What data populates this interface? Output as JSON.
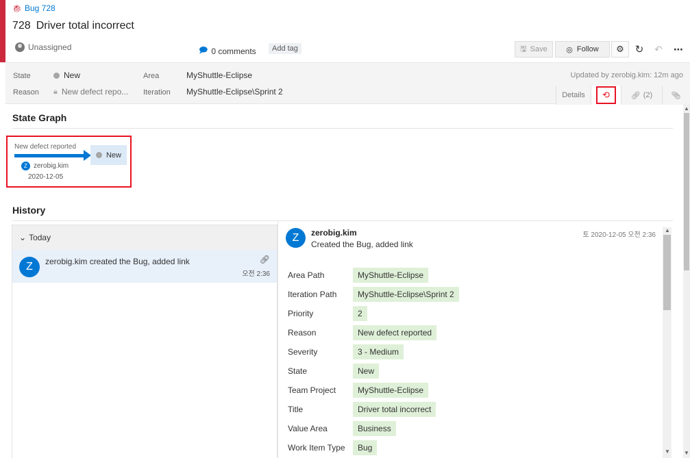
{
  "header": {
    "bug_label": "Bug 728",
    "item_id": "728",
    "title": "Driver total incorrect",
    "assigned": "Unassigned",
    "comments": "0 comments",
    "add_tag": "Add tag",
    "accent_color": "#cc293d"
  },
  "toolbar": {
    "save": "Save",
    "follow": "Follow",
    "icons": [
      "save-icon",
      "eye-icon",
      "gear-icon",
      "refresh-icon",
      "undo-icon",
      "more-icon"
    ]
  },
  "fields": {
    "state_label": "State",
    "state_value": "New",
    "reason_label": "Reason",
    "reason_value": "New defect repo...",
    "area_label": "Area",
    "area_value": "MyShuttle-Eclipse",
    "iteration_label": "Iteration",
    "iteration_value": "MyShuttle-Eclipse\\Sprint 2",
    "updated": "Updated by zerobig.kim: 12m ago"
  },
  "tabs": {
    "details": "Details",
    "links_count": "(2)"
  },
  "state_graph": {
    "title": "State Graph",
    "reason": "New defect reported",
    "state": "New",
    "user": "zerobig.kim",
    "user_initial": "Z",
    "date": "2020-12-05"
  },
  "history": {
    "title": "History",
    "group": "Today",
    "entry": {
      "initial": "Z",
      "text": "zerobig.kim created the Bug, added link",
      "time": "오전 2:36"
    },
    "detail": {
      "initial": "Z",
      "user": "zerobig.kim",
      "desc": "Created the Bug, added link",
      "date": "토 2020-12-05 오전 2:36",
      "rows": [
        {
          "label": "Area Path",
          "value": "MyShuttle-Eclipse"
        },
        {
          "label": "Iteration Path",
          "value": "MyShuttle-Eclipse\\Sprint 2"
        },
        {
          "label": "Priority",
          "value": "2"
        },
        {
          "label": "Reason",
          "value": "New defect reported"
        },
        {
          "label": "Severity",
          "value": "3 - Medium"
        },
        {
          "label": "State",
          "value": "New"
        },
        {
          "label": "Team Project",
          "value": "MyShuttle-Eclipse"
        },
        {
          "label": "Title",
          "value": "Driver total incorrect"
        },
        {
          "label": "Value Area",
          "value": "Business"
        },
        {
          "label": "Work Item Type",
          "value": "Bug"
        }
      ]
    }
  }
}
